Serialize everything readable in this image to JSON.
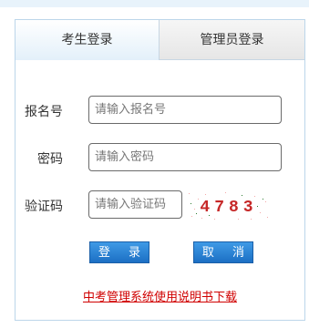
{
  "tabs": {
    "student": "考生登录",
    "admin": "管理员登录"
  },
  "form": {
    "reg_label": "报名号",
    "reg_placeholder": "请输入报名号",
    "password_label": "密码",
    "password_placeholder": "请输入密码",
    "captcha_label": "验证码",
    "captcha_placeholder": "请输入验证码",
    "captcha_text": "4783"
  },
  "buttons": {
    "login": "登 录",
    "cancel": "取 消"
  },
  "link": {
    "manual": "中考管理系统使用说明书下载"
  },
  "colors": {
    "tab_active_bg": "#e3f0fa",
    "button_blue": "#1c6fc4",
    "link_red": "#d00000",
    "captcha_red": "#c62828"
  }
}
